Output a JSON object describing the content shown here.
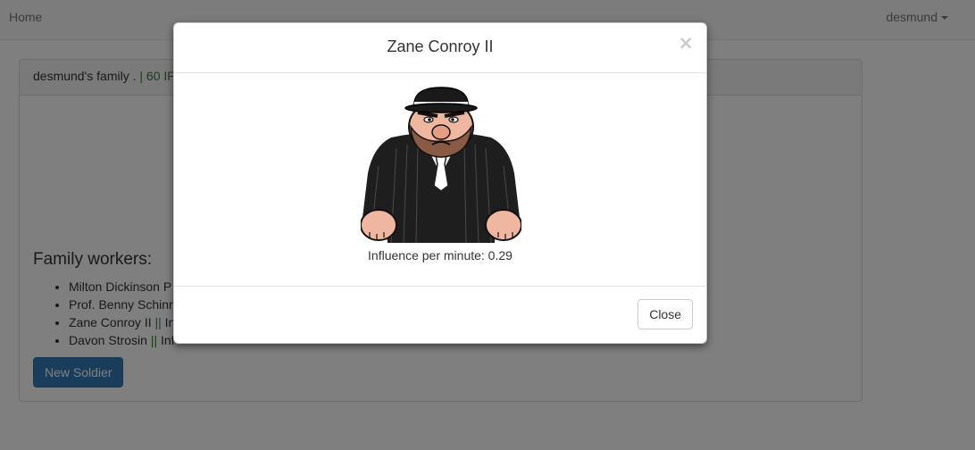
{
  "navbar": {
    "home": "Home",
    "user": "desmund"
  },
  "panel": {
    "family_name": "desmund's family .",
    "separator": "|",
    "ip": "60 IP",
    "workers_title": "Family workers:",
    "workers": [
      {
        "name": "Milton Dickinson P",
        "sep": "",
        "rest": ""
      },
      {
        "name": "Prof. Benny Schinne",
        "sep": "",
        "rest": ""
      },
      {
        "name": "Zane Conroy II ",
        "sep": "||",
        "rest": " In"
      },
      {
        "name": "Davon Strosin ",
        "sep": "||",
        "rest": " Inf"
      }
    ],
    "new_soldier": "New Soldier"
  },
  "modal": {
    "title": "Zane Conroy II",
    "close_x": "×",
    "portrait_icon": "mobster-portrait-icon",
    "influence": "Influence per minute: 0.29",
    "close_button": "Close"
  }
}
